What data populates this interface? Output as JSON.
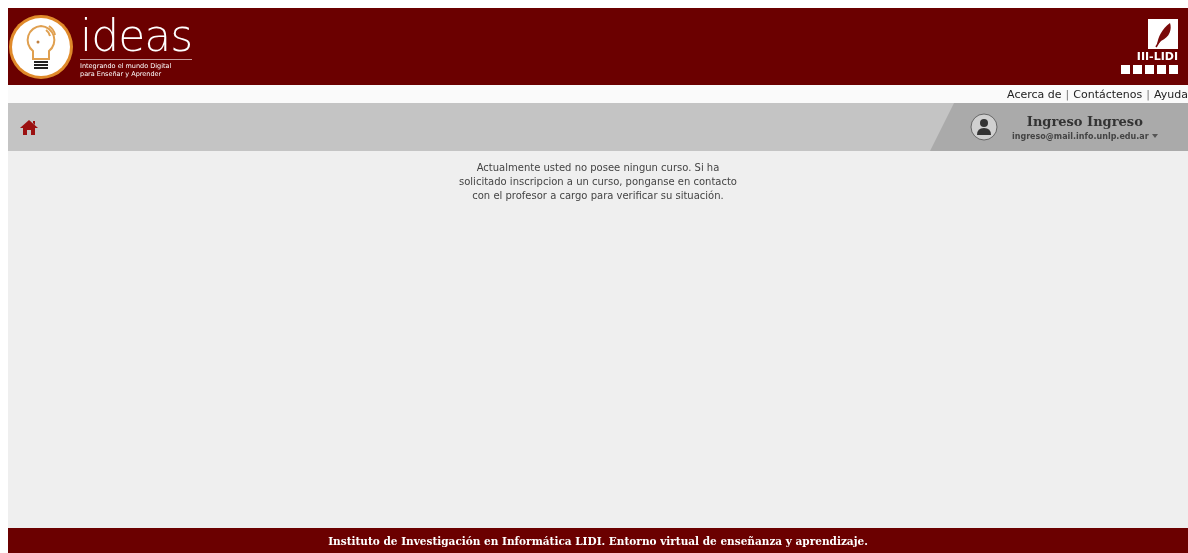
{
  "header": {
    "logo_text": "ideas",
    "tagline": [
      "Integrando el mundo Digital",
      "para Enseñar y Aprender"
    ],
    "partner_logo_text": "III-LIDI"
  },
  "top_links": [
    {
      "kind": "link",
      "label": "Acerca de"
    },
    {
      "kind": "separator",
      "label": "|"
    },
    {
      "kind": "link",
      "label": "Contáctenos"
    },
    {
      "kind": "separator",
      "label": "|"
    },
    {
      "kind": "link",
      "label": "Ayuda"
    }
  ],
  "user": {
    "name": "Ingreso Ingreso",
    "email": "ingreso@mail.info.unlp.edu.ar"
  },
  "message": "Actualmente usted no posee ningun curso. Si ha solicitado inscripcion a un curso, ponganse en contacto con el profesor a cargo para verificar su situación.",
  "footer": "Instituto de Investigación en Informática LIDI. Entorno virtual de enseñanza y aprendizaje."
}
